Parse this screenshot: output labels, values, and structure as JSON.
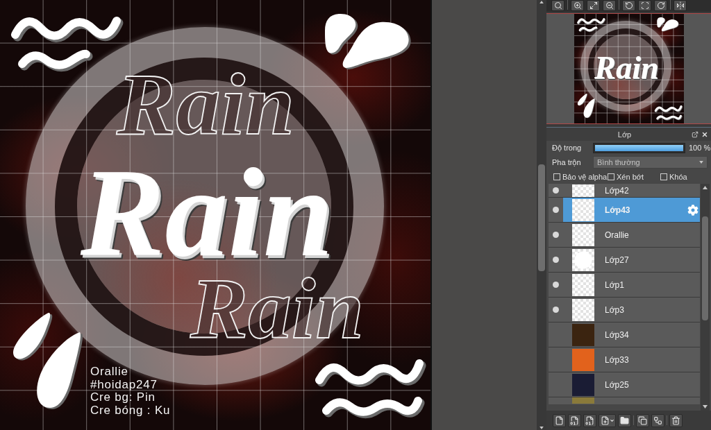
{
  "canvas": {
    "titles": [
      {
        "kind": "outline",
        "text": "Rain"
      },
      {
        "kind": "solid",
        "text": "Rain"
      },
      {
        "kind": "outline",
        "text": "Rain"
      }
    ],
    "credits": [
      "Orallie",
      "#hoidap247",
      "Cre bg: Pin",
      "Cre bóng : Ku"
    ]
  },
  "navigator": {
    "titles": [
      {
        "kind": "solid",
        "text": "Rain"
      }
    ]
  },
  "layers_panel": {
    "title": "Lớp",
    "opacity": {
      "label": "Độ trong",
      "level": 1,
      "reading": "100 %"
    },
    "blend": {
      "label": "Pha trộn",
      "value": "Bình thường"
    },
    "options": [
      {
        "label": "Bảo vệ alpha",
        "checked": false
      },
      {
        "label": "Xén bớt",
        "checked": false
      },
      {
        "label": "Khóa",
        "checked": false
      }
    ],
    "layers": [
      {
        "name": "Lớp42",
        "visible": true,
        "selected": false,
        "thumbnail": {
          "kind": "transparent"
        }
      },
      {
        "name": "Lớp43",
        "visible": true,
        "selected": true,
        "thumbnail": {
          "kind": "transparent"
        }
      },
      {
        "name": "Orallie",
        "visible": true,
        "selected": false,
        "thumbnail": {
          "kind": "transparent"
        }
      },
      {
        "name": "Lớp27",
        "visible": true,
        "selected": false,
        "thumbnail": {
          "kind": "circle"
        }
      },
      {
        "name": "Lớp1",
        "visible": true,
        "selected": false,
        "thumbnail": {
          "kind": "transparent"
        }
      },
      {
        "name": "Lớp3",
        "visible": true,
        "selected": false,
        "thumbnail": {
          "kind": "transparent"
        }
      },
      {
        "name": "Lớp34",
        "visible": false,
        "selected": false,
        "thumbnail": {
          "kind": "photo",
          "color": "#3b2410"
        }
      },
      {
        "name": "Lớp33",
        "visible": false,
        "selected": false,
        "thumbnail": {
          "kind": "photo",
          "color": "#e2621c"
        }
      },
      {
        "name": "Lớp25",
        "visible": false,
        "selected": false,
        "thumbnail": {
          "kind": "photo",
          "color": "#1a1c34"
        }
      },
      {
        "visible": false,
        "selected": false,
        "thumbnail": {
          "kind": "photo",
          "color": "#8a7a3a"
        }
      }
    ]
  }
}
